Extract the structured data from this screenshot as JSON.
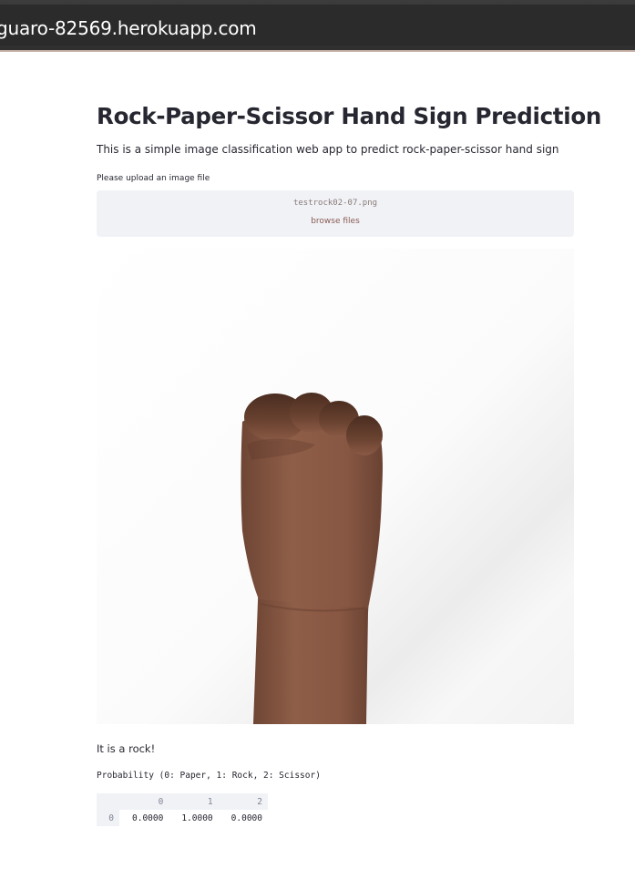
{
  "browser": {
    "url": "guaro-82569.herokuapp.com"
  },
  "page": {
    "title": "Rock-Paper-Scissor Hand Sign Prediction",
    "subtitle": "This is a simple image classification web app to predict rock-paper-scissor hand sign"
  },
  "uploader": {
    "label": "Please upload an image file",
    "file_name": "testrock02-07.png",
    "browse_label": "browse files"
  },
  "result": {
    "text": "It is a rock!",
    "probability_label": "Probability (0: Paper, 1: Rock, 2: Scissor)"
  },
  "probability_table": {
    "columns": [
      "",
      "0",
      "1",
      "2"
    ],
    "rows": [
      {
        "index": "0",
        "values": [
          "0.0000",
          "1.0000",
          "0.0000"
        ]
      }
    ]
  },
  "colors": {
    "skin": "#8a5a45",
    "skin_shadow": "#5e3a2a",
    "uploader_bg": "#f0f2f6"
  }
}
